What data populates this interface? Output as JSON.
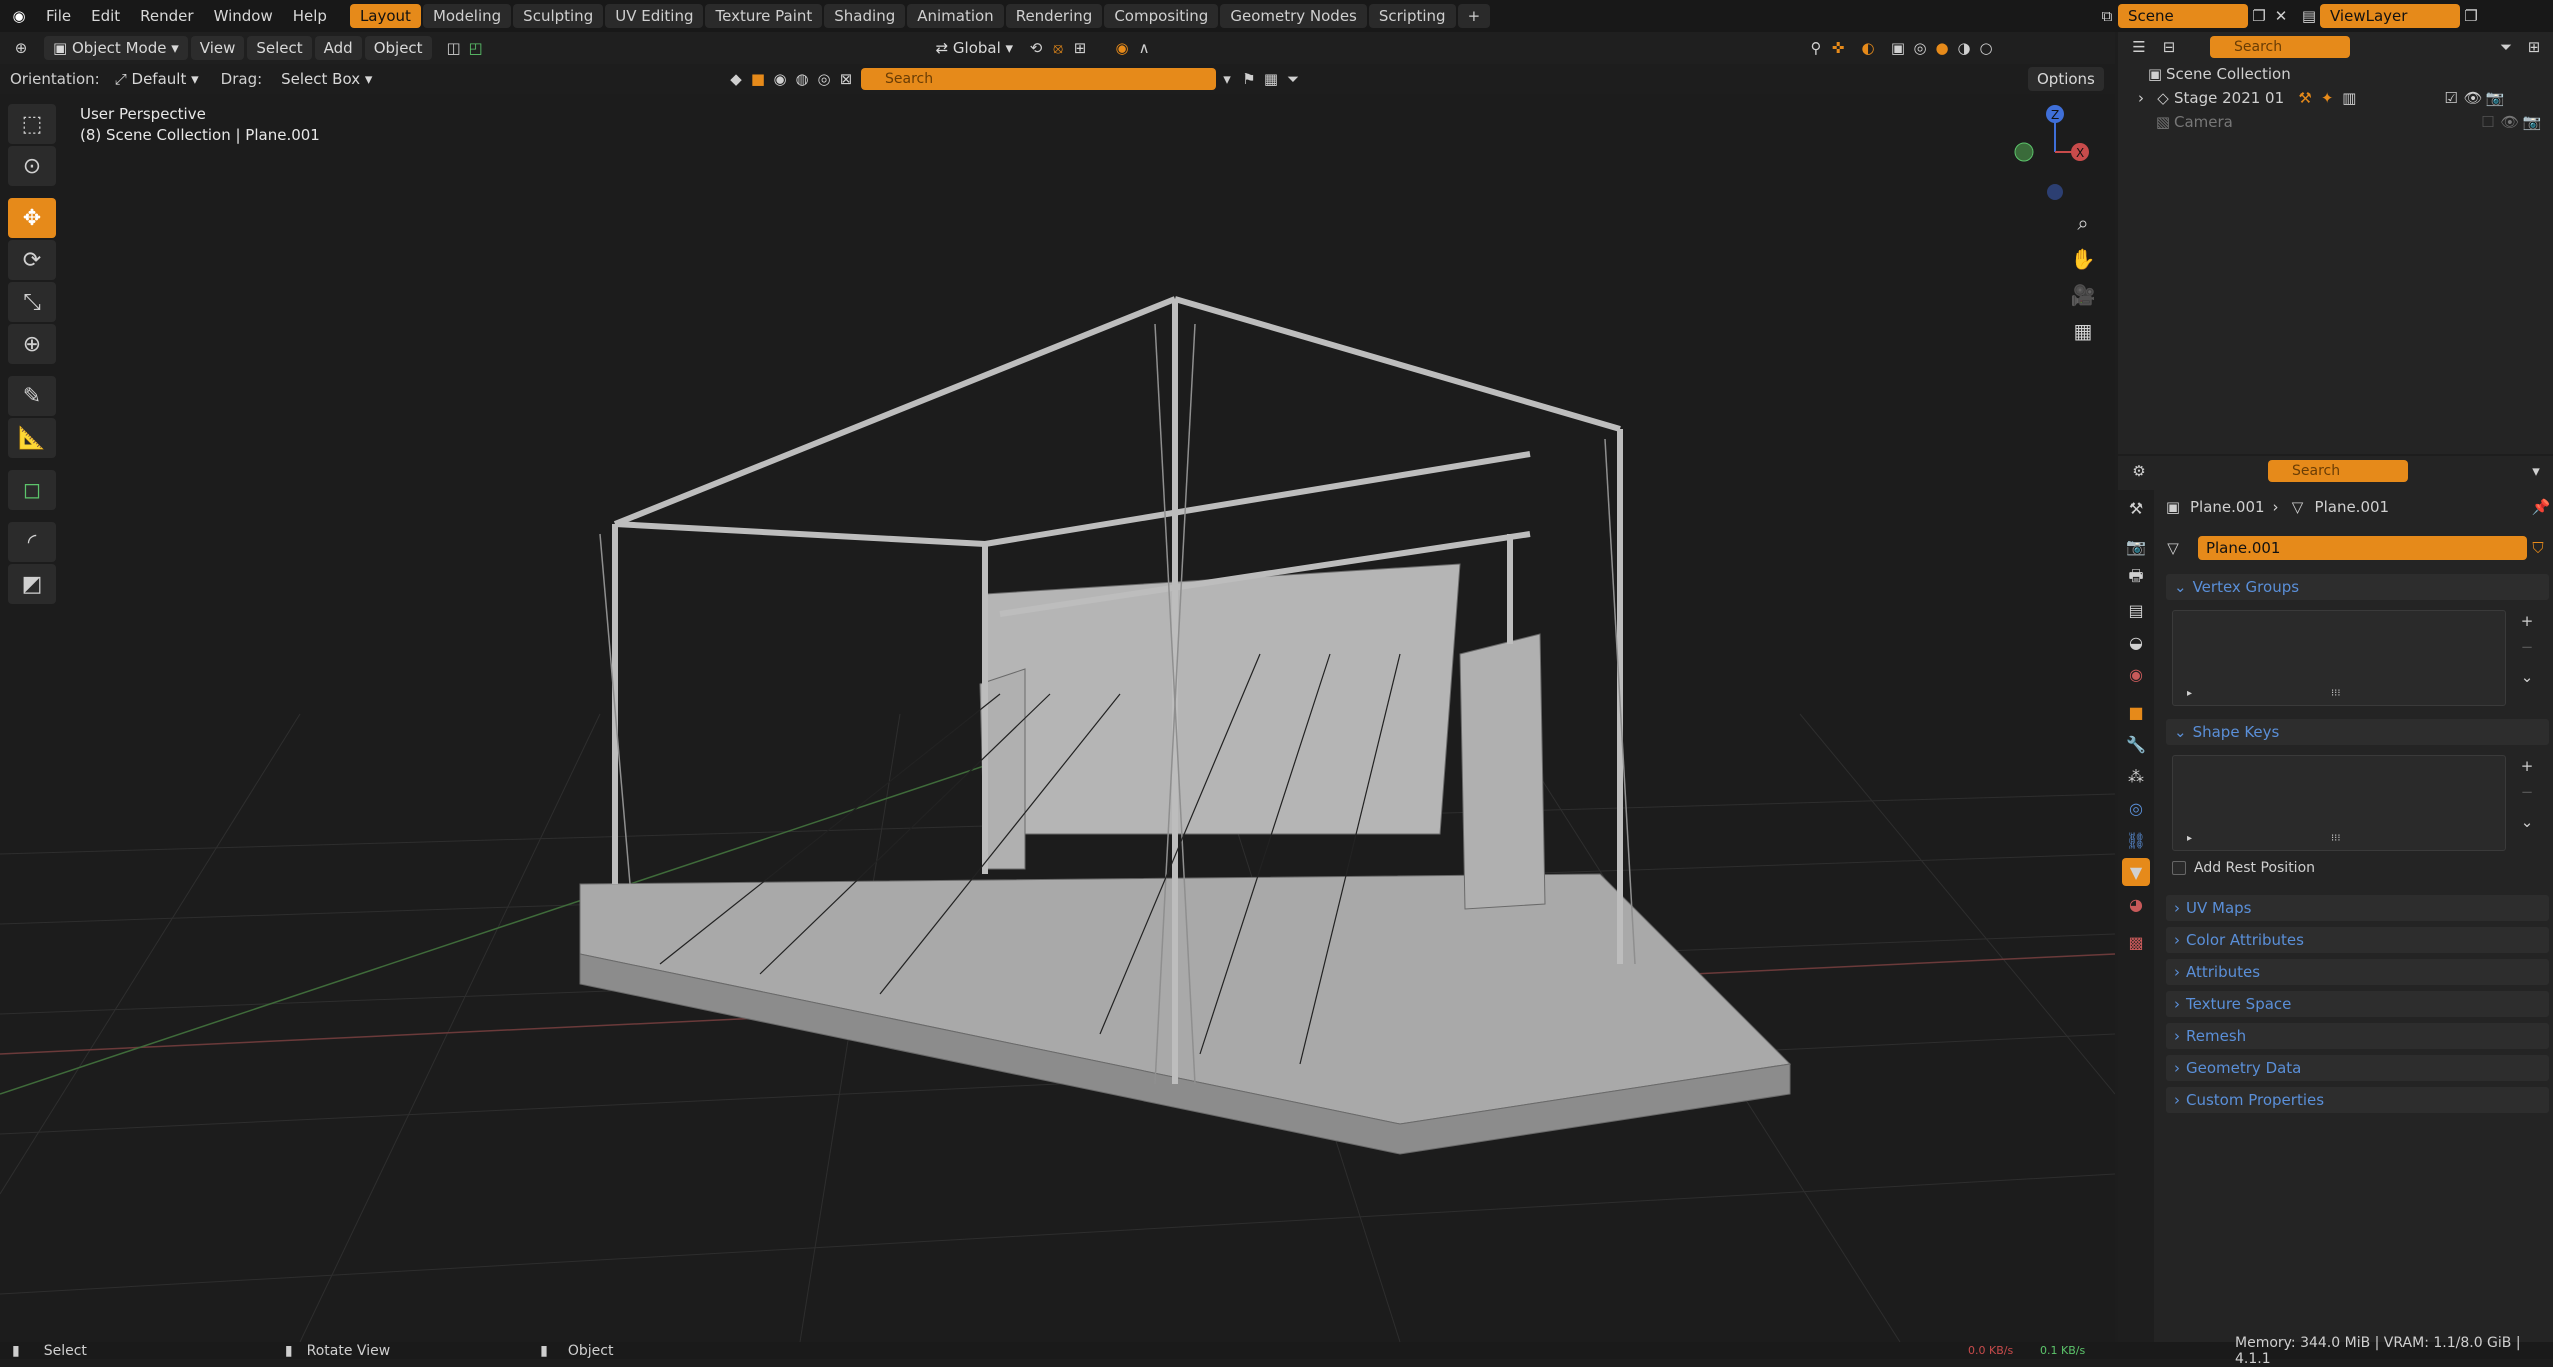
{
  "topbar": {
    "menus": [
      "File",
      "Edit",
      "Render",
      "Window",
      "Help"
    ],
    "workspaces": [
      "Layout",
      "Modeling",
      "Sculpting",
      "UV Editing",
      "Texture Paint",
      "Shading",
      "Animation",
      "Rendering",
      "Compositing",
      "Geometry Nodes",
      "Scripting"
    ],
    "active_workspace": "Layout",
    "scene": "Scene",
    "view_layer": "ViewLayer"
  },
  "viewport_header": {
    "mode": "Object Mode",
    "menus": [
      "View",
      "Select",
      "Add",
      "Object"
    ],
    "transform": "Global",
    "search_placeholder": "Search",
    "orientation_label": "Orientation:",
    "orientation_value": "Default",
    "drag_label": "Drag:",
    "drag_value": "Select Box",
    "options": "Options"
  },
  "viewport_info": {
    "line1": "User Perspective",
    "line2": "(8) Scene Collection | Plane.001"
  },
  "gizmo": {
    "z": "Z",
    "x": "X"
  },
  "outliner": {
    "search_placeholder": "Search",
    "items": [
      {
        "label": "Scene Collection",
        "dim": false
      },
      {
        "label": "Stage 2021 01",
        "dim": false
      },
      {
        "label": "Camera",
        "dim": true
      }
    ]
  },
  "properties": {
    "search_placeholder": "Search",
    "breadcrumb": [
      "Plane.001",
      "Plane.001"
    ],
    "data_name": "Plane.001",
    "panels": [
      "Vertex Groups",
      "Shape Keys",
      "UV Maps",
      "Color Attributes",
      "Attributes",
      "Texture Space",
      "Remesh",
      "Geometry Data",
      "Custom Properties"
    ],
    "add_rest_position": "Add Rest Position"
  },
  "statusbar": {
    "select": "Select",
    "rotate": "Rotate View",
    "object": "Object",
    "net_down": "0.0 KB/s",
    "net_up": "0.1 KB/s",
    "memory": "Memory: 344.0 MiB | VRAM: 1.1/8.0 GiB | 4.1.1"
  },
  "colors": {
    "accent": "#e68a1a",
    "panel_title": "#5a8fd8",
    "bg": "#1d1d1d"
  }
}
